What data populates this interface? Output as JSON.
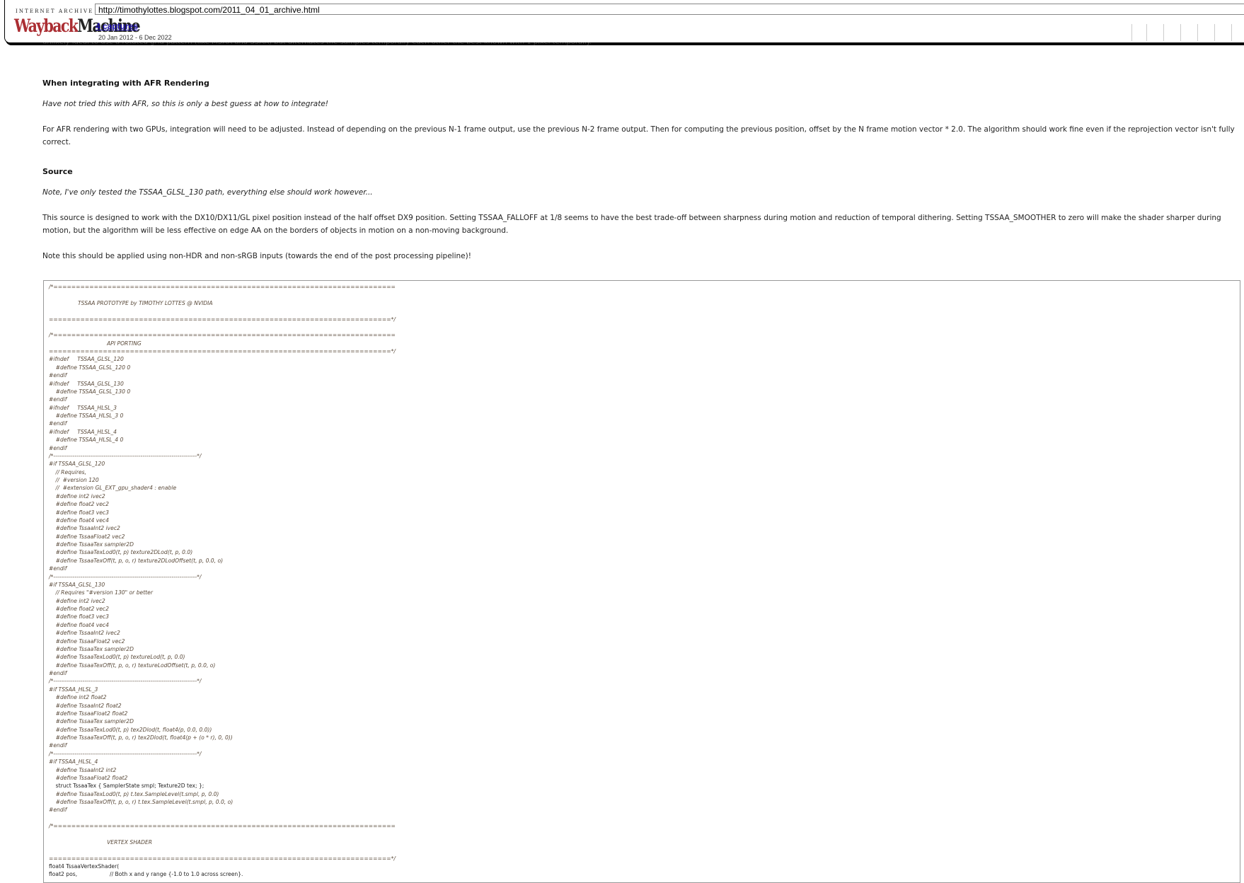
{
  "wayback": {
    "brand_top": "INTERNET ARCHIVE",
    "brand_wayback": "Wayback",
    "brand_machine": "Machine",
    "url": "http://timothylottes.blogspot.com/2011_04_01_archive.html",
    "captures_link": "4 captures",
    "date_range": "20 Jan 2012 - 6 Dec 2022"
  },
  "article": {
    "cut_text": "unlikely ideal to use a rotated grid pattern (like MSAA and SSAA) but alternates the samples temporally each other the best known with 1 pixel temporally.",
    "afr_heading": "When integrating with AFR Rendering",
    "afr_note": "Have not tried this with AFR, so this is only a best guess at how to integrate!",
    "afr_body": "For AFR rendering with two GPUs, integration will need to be adjusted. Instead of depending on the previous N-1 frame output, use the previous N-2 frame output. Then for computing the previous position, offset by the N frame motion vector * 2.0. The algorithm should work fine even if the reprojection vector isn't fully correct.",
    "source_heading": "Source",
    "source_note": "Note, I've only tested the TSSAA_GLSL_130 path, everything else should work however...",
    "source_body": "This source is designed to work with the DX10/DX11/GL pixel position instead of the half offset DX9 position. Setting TSSAA_FALLOFF at 1/8 seems to have the best trade-off between sharpness during motion and reduction of temporal dithering. Setting TSSAA_SMOOTHER to zero will make the shader sharper during motion, but the algorithm will be less effective on edge AA on the borders of objects in motion on a non-moving background.",
    "source_note2": "Note this should be applied using non-HDR and non-sRGB inputs (towards the end of the post processing pipeline)!"
  },
  "code_lines": [
    "/*============================================================================",
    "",
    "                 TSSAA PROTOTYPE by TIMOTHY LOTTES @ NVIDIA",
    "",
    "============================================================================*/",
    "",
    "/*============================================================================",
    "                                  API PORTING",
    "============================================================================*/",
    "#ifndef     TSSAA_GLSL_120",
    "    #define TSSAA_GLSL_120 0",
    "#endif",
    "#ifndef     TSSAA_GLSL_130",
    "    #define TSSAA_GLSL_130 0",
    "#endif",
    "#ifndef     TSSAA_HLSL_3",
    "    #define TSSAA_HLSL_3 0",
    "#endif",
    "#ifndef     TSSAA_HLSL_4",
    "    #define TSSAA_HLSL_4 0",
    "#endif",
    "/*--------------------------------------------------------------------------*/",
    "#if TSSAA_GLSL_120",
    "    // Requires,",
    "    //  #version 120",
    "    //  #extension GL_EXT_gpu_shader4 : enable",
    "    #define int2 ivec2",
    "    #define float2 vec2",
    "    #define float3 vec3",
    "    #define float4 vec4",
    "    #define TssaaInt2 ivec2",
    "    #define TssaaFloat2 vec2",
    "    #define TssaaTex sampler2D",
    "    #define TssaaTexLod0(t, p) texture2DLod(t, p, 0.0)",
    "    #define TssaaTexOff(t, p, o, r) texture2DLodOffset(t, p, 0.0, o)",
    "#endif",
    "/*--------------------------------------------------------------------------*/",
    "#if TSSAA_GLSL_130",
    "    // Requires \"#version 130\" or better",
    "    #define int2 ivec2",
    "    #define float2 vec2",
    "    #define float3 vec3",
    "    #define float4 vec4",
    "    #define TssaaInt2 ivec2",
    "    #define TssaaFloat2 vec2",
    "    #define TssaaTex sampler2D",
    "    #define TssaaTexLod0(t, p) textureLod(t, p, 0.0)",
    "    #define TssaaTexOff(t, p, o, r) textureLodOffset(t, p, 0.0, o)",
    "#endif",
    "/*--------------------------------------------------------------------------*/",
    "#if TSSAA_HLSL_3",
    "    #define int2 float2",
    "    #define TssaaInt2 float2",
    "    #define TssaaFloat2 float2",
    "    #define TssaaTex sampler2D",
    "    #define TssaaTexLod0(t, p) tex2Dlod(t, float4(p, 0.0, 0.0))",
    "    #define TssaaTexOff(t, p, o, r) tex2Dlod(t, float4(p + (o * r), 0, 0))",
    "#endif",
    "/*--------------------------------------------------------------------------*/",
    "#if TSSAA_HLSL_4",
    "    #define TssaaInt2 int2",
    "    #define TssaaFloat2 float2",
    "    struct TssaaTex { SamplerState smpl; Texture2D tex; };",
    "    #define TssaaTexLod0(t, p) t.tex.SampleLevel(t.smpl, p, 0.0)",
    "    #define TssaaTexOff(t, p, o, r) t.tex.SampleLevel(t.smpl, p, 0.0, o)",
    "#endif",
    "",
    "/*============================================================================",
    "",
    "                                  VERTEX SHADER",
    "",
    "============================================================================*/",
    "float4 TssaaVertexShader(",
    "float2 pos,                   // Both x and y range {-1.0 to 1.0 across screen}."
  ]
}
